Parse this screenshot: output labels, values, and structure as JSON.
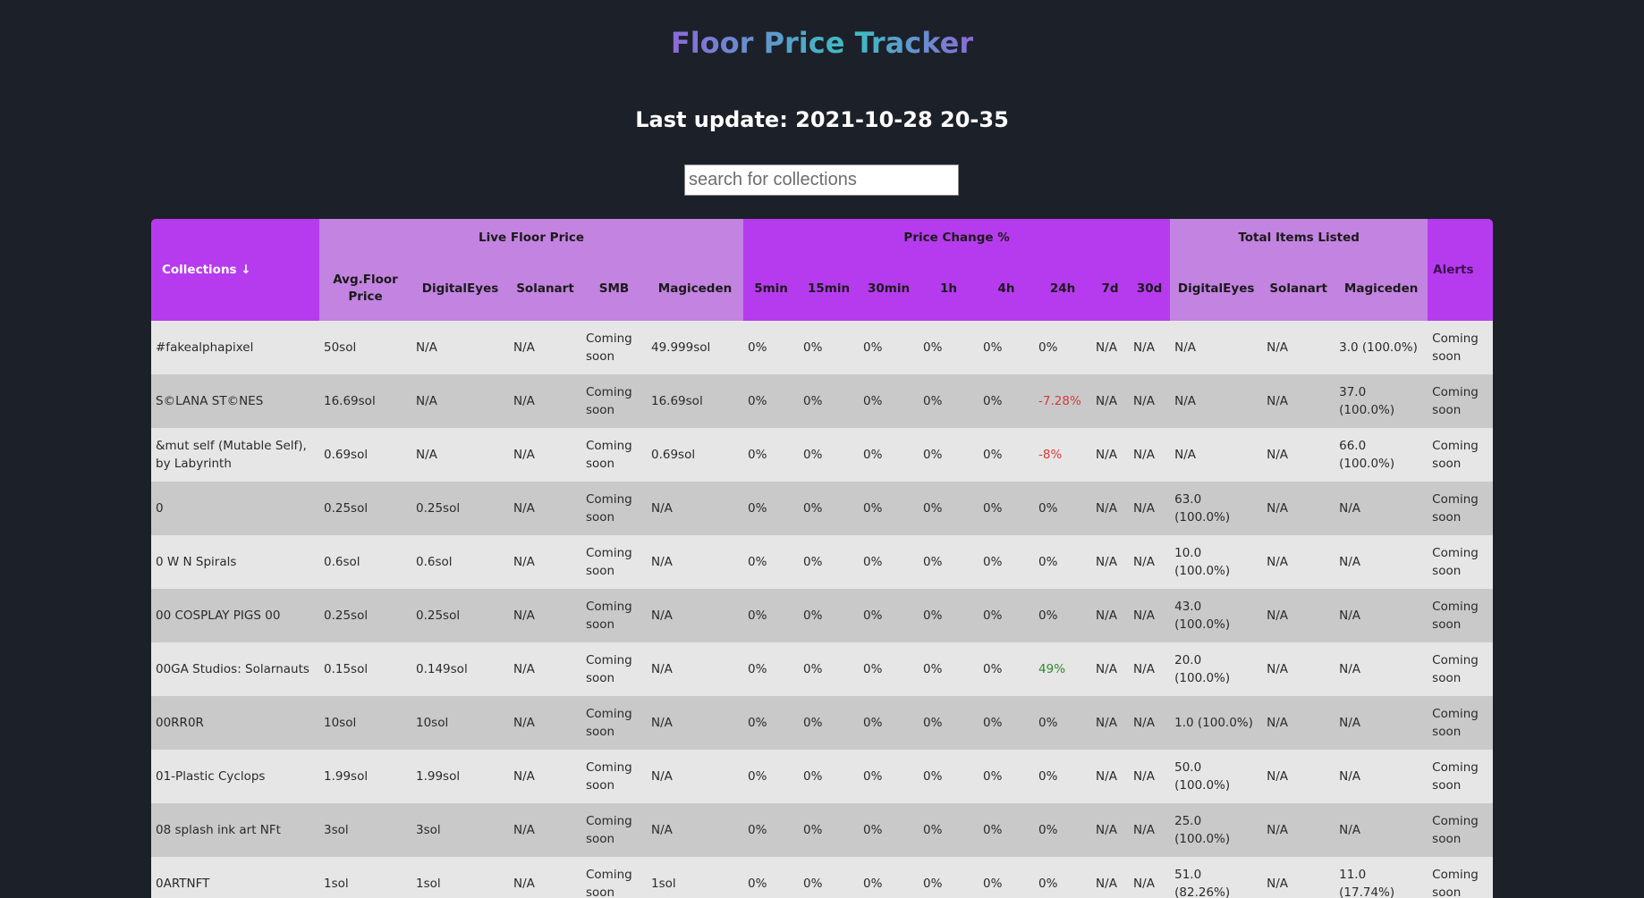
{
  "title": "Floor Price Tracker",
  "last_update": "Last update: 2021-10-28 20-35",
  "search": {
    "placeholder": "search for collections"
  },
  "table": {
    "groups": {
      "live_floor": "Live Floor Price",
      "price_change": "Price Change %",
      "total_items": "Total Items Listed"
    },
    "headers": {
      "collections": "Collections ↓",
      "alerts": "Alerts",
      "live": [
        "Avg.Floor Price",
        "DigitalEyes",
        "Solanart",
        "SMB",
        "Magiceden"
      ],
      "change": [
        "5min",
        "15min",
        "30min",
        "1h",
        "4h",
        "24h",
        "7d",
        "30d"
      ],
      "items": [
        "DigitalEyes",
        "Solanart",
        "Magiceden"
      ]
    },
    "rows": [
      [
        "#fakealphapixel",
        "50sol",
        "N/A",
        "N/A",
        "Coming soon",
        "49.999sol",
        "0%",
        "0%",
        "0%",
        "0%",
        "0%",
        "0%",
        "N/A",
        "N/A",
        "N/A",
        "N/A",
        "3.0 (100.0%)",
        "Coming soon"
      ],
      [
        "S©LANA ST©NES",
        "16.69sol",
        "N/A",
        "N/A",
        "Coming soon",
        "16.69sol",
        "0%",
        "0%",
        "0%",
        "0%",
        "0%",
        "-7.28%",
        "N/A",
        "N/A",
        "N/A",
        "N/A",
        "37.0 (100.0%)",
        "Coming soon"
      ],
      [
        "&mut self (Mutable Self), by Labyrinth",
        "0.69sol",
        "N/A",
        "N/A",
        "Coming soon",
        "0.69sol",
        "0%",
        "0%",
        "0%",
        "0%",
        "0%",
        "-8%",
        "N/A",
        "N/A",
        "N/A",
        "N/A",
        "66.0 (100.0%)",
        "Coming soon"
      ],
      [
        "0",
        "0.25sol",
        "0.25sol",
        "N/A",
        "Coming soon",
        "N/A",
        "0%",
        "0%",
        "0%",
        "0%",
        "0%",
        "0%",
        "N/A",
        "N/A",
        "63.0 (100.0%)",
        "N/A",
        "N/A",
        "Coming soon"
      ],
      [
        "0 W N Spirals",
        "0.6sol",
        "0.6sol",
        "N/A",
        "Coming soon",
        "N/A",
        "0%",
        "0%",
        "0%",
        "0%",
        "0%",
        "0%",
        "N/A",
        "N/A",
        "10.0 (100.0%)",
        "N/A",
        "N/A",
        "Coming soon"
      ],
      [
        "00 COSPLAY PIGS 00",
        "0.25sol",
        "0.25sol",
        "N/A",
        "Coming soon",
        "N/A",
        "0%",
        "0%",
        "0%",
        "0%",
        "0%",
        "0%",
        "N/A",
        "N/A",
        "43.0 (100.0%)",
        "N/A",
        "N/A",
        "Coming soon"
      ],
      [
        "00GA Studios: Solarnauts",
        "0.15sol",
        "0.149sol",
        "N/A",
        "Coming soon",
        "N/A",
        "0%",
        "0%",
        "0%",
        "0%",
        "0%",
        "49%",
        "N/A",
        "N/A",
        "20.0 (100.0%)",
        "N/A",
        "N/A",
        "Coming soon"
      ],
      [
        "00RR0R",
        "10sol",
        "10sol",
        "N/A",
        "Coming soon",
        "N/A",
        "0%",
        "0%",
        "0%",
        "0%",
        "0%",
        "0%",
        "N/A",
        "N/A",
        "1.0 (100.0%)",
        "N/A",
        "N/A",
        "Coming soon"
      ],
      [
        "01-Plastic Cyclops",
        "1.99sol",
        "1.99sol",
        "N/A",
        "Coming soon",
        "N/A",
        "0%",
        "0%",
        "0%",
        "0%",
        "0%",
        "0%",
        "N/A",
        "N/A",
        "50.0 (100.0%)",
        "N/A",
        "N/A",
        "Coming soon"
      ],
      [
        "08 splash ink art NFt",
        "3sol",
        "3sol",
        "N/A",
        "Coming soon",
        "N/A",
        "0%",
        "0%",
        "0%",
        "0%",
        "0%",
        "0%",
        "N/A",
        "N/A",
        "25.0 (100.0%)",
        "N/A",
        "N/A",
        "Coming soon"
      ],
      [
        "0ARTNFT",
        "1sol",
        "1sol",
        "N/A",
        "Coming soon",
        "1sol",
        "0%",
        "0%",
        "0%",
        "0%",
        "0%",
        "0%",
        "N/A",
        "N/A",
        "51.0 (82.26%)",
        "N/A",
        "11.0 (17.74%)",
        "Coming soon"
      ]
    ],
    "colors": {
      "negative": "#d63a3a",
      "positive": "#2c8a2c",
      "header_light": "#c383e0",
      "header_bright": "#b73bee"
    }
  }
}
